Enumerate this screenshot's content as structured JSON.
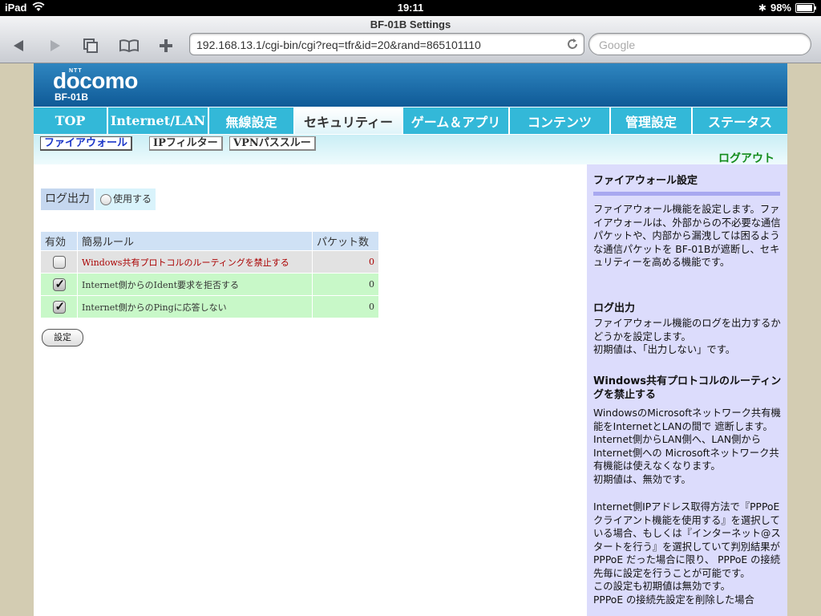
{
  "status_bar": {
    "device": "iPad",
    "time": "19:11",
    "battery": "98%"
  },
  "browser": {
    "page_title": "BF-01B Settings",
    "url": "192.168.13.1/cgi-bin/cgi?req=tfr&id=20&rand=865101110",
    "search_placeholder": "Google"
  },
  "header": {
    "logo_small": "NTT",
    "logo": "docomo",
    "model": "BF-01B"
  },
  "nav": {
    "tabs": [
      {
        "label": "TOP"
      },
      {
        "label": "Internet/LAN"
      },
      {
        "label": "無線設定"
      },
      {
        "label": "セキュリティー"
      },
      {
        "label": "ゲーム＆アプリ"
      },
      {
        "label": "コンテンツ"
      },
      {
        "label": "管理設定"
      },
      {
        "label": "ステータス"
      }
    ]
  },
  "subnav": {
    "tabs": [
      {
        "label": "ファイアウォール"
      },
      {
        "label": "IPフィルター"
      },
      {
        "label": "VPNパススルー"
      }
    ],
    "logout": "ログアウト"
  },
  "log_output": {
    "label": "ログ出力",
    "option": "使用する"
  },
  "rules_table": {
    "headers": {
      "enabled": "有効",
      "rule": "簡易ルール",
      "packets": "パケット数"
    },
    "rows": [
      {
        "rule": "Windows共有プロトコルのルーティングを禁止する",
        "packets": "0",
        "enabled": false
      },
      {
        "rule": "Internet側からのIdent要求を拒否する",
        "packets": "0",
        "enabled": true
      },
      {
        "rule": "Internet側からのPingに応答しない",
        "packets": "0",
        "enabled": true
      }
    ]
  },
  "set_button": "設定",
  "help": {
    "title": "ファイアウォール設定",
    "intro": "ファイアウォール機能を設定します。ファイアウォールは、外部からの不必要な通信パケットや、内部から漏洩しては困るような通信パケットを BF-01Bが遮断し、セキュリティーを高める機能です。",
    "log_title": "ログ出力",
    "log_text": "ファイアウォール機能のログを出力するかどうかを設定します。\n初期値は、「出力しない」です。",
    "windows_title": "Windows共有プロトコルのルーティングを禁止する",
    "windows_text": "WindowsのMicrosoftネットワーク共有機能をInternetとLANの間で 遮断します。Internet側からLAN側へ、LAN側からInternet側への Microsoftネットワーク共有機能は使えなくなります。\n初期値は、無効です。",
    "pppoe_text": "Internet側IPアドレス取得方法で『PPPoEクライアント機能を使用する』を選択している場合、もしくは『インターネット@スタートを行う』を選択していて判別結果が PPPoE だった場合に限り、 PPPoE の接続先毎に設定を行うことが可能です。\nこの設定も初期値は無効です。\nPPPoE の接続先設定を削除した場合"
  }
}
